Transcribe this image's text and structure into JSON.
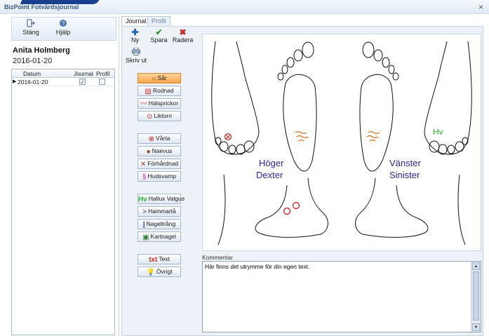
{
  "window": {
    "title": "BizPoint Fotvårdsjournal",
    "close": "×"
  },
  "toolbar": {
    "close_label": "Stäng",
    "help_label": "Hjälp"
  },
  "patient": {
    "name": "Anita Holmberg",
    "date": "2016-01-20"
  },
  "visits": {
    "headers": [
      "Datum",
      "Journal",
      "Profil"
    ],
    "rows": [
      {
        "date": "2016-01-20",
        "journal": true,
        "profil": false
      }
    ]
  },
  "tabs": [
    {
      "label": "Journal",
      "active": true
    },
    {
      "label": "Profil",
      "active": false
    }
  ],
  "actions": {
    "new_label": "Ny",
    "save_label": "Spara",
    "delete_label": "Radera",
    "print_label": "Skriv ut"
  },
  "stamps": {
    "sar": "Sår",
    "rodnad": "Rodnad",
    "halsprickor": "Hälsprickor",
    "liktorn": "Liktorn",
    "varta": "Vårta",
    "naevus": "Naevus",
    "forhardnad": "Förhårdnad",
    "hudsvamp": "Hudsvamp",
    "hallux": "Hallux Valgus",
    "hammarta": "Hammartå",
    "nageltrang": "Nageltrång",
    "kartnagel": "Kartnagel",
    "text": "Text",
    "ovrigt": "Övrigt"
  },
  "diagram": {
    "right_line1": "Höger",
    "right_line2": "Dexter",
    "left_line1": "Vänster",
    "left_line2": "Sinister",
    "hv_marker": "Hv"
  },
  "comment": {
    "label": "Kommentar",
    "value": "Här finns det utrymme för din egen text."
  },
  "colors": {
    "accent_orange": "#f6a64a",
    "label_blue": "#2a1fa3",
    "mark_red": "#c0392b",
    "hv_green": "#2eb82e"
  }
}
